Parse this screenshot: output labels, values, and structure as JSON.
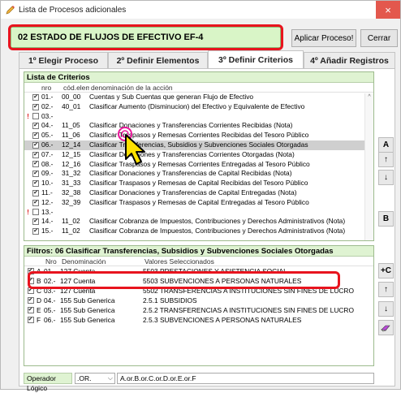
{
  "window": {
    "title": "Lista de Procesos adicionales",
    "close_label": "×"
  },
  "process": {
    "name": "02 ESTADO DE FLUJOS DE EFECTIVO EF-4"
  },
  "buttons": {
    "apply": "Aplicar Proceso!",
    "close": "Cerrar"
  },
  "tabs": [
    {
      "label": "1º Elegir Proceso"
    },
    {
      "label": "2º Definir Elementos"
    },
    {
      "label": "3º Definir Criterios"
    },
    {
      "label": "4º Añadir Registros"
    }
  ],
  "criteria": {
    "title": "Lista de Criterios",
    "headers": {
      "nro": "nro",
      "cod": "cód.elemen",
      "den": "denominación de la acción"
    },
    "rows": [
      {
        "mark": "",
        "checked": "✔",
        "nro": "01.-",
        "cod": "00_00",
        "den": "Cuentas y Sub Cuentas que generan Flujo de Efectivo"
      },
      {
        "mark": "",
        "checked": "✔",
        "nro": "02.-",
        "cod": "40_01",
        "den": "Clasificar Aumento (Disminucion) del Efectivo y Equivalente de Efectivo"
      },
      {
        "mark": "!",
        "checked": "",
        "nro": "03.-",
        "cod": "",
        "den": ""
      },
      {
        "mark": "",
        "checked": "✔",
        "nro": "04.-",
        "cod": "11_05",
        "den": "Clasificar Donaciones y Transferencias Corrientes Recibidas (Nota)"
      },
      {
        "mark": "",
        "checked": "✔",
        "nro": "05.-",
        "cod": "11_06",
        "den": "Clasificar Traspasos y Remesas Corrientes Recibidas del Tesoro Público"
      },
      {
        "mark": "",
        "checked": "✔",
        "nro": "06.-",
        "cod": "12_14",
        "den": "Clasificar Transferencias, Subsidios y Subvenciones Sociales Otorgadas"
      },
      {
        "mark": "",
        "checked": "✔",
        "nro": "07.-",
        "cod": "12_15",
        "den": "Clasificar Donaciones y Transferencias Corrientes Otorgadas (Nota)"
      },
      {
        "mark": "",
        "checked": "✔",
        "nro": "08.-",
        "cod": "12_16",
        "den": "Clasificar Traspasos y Remesas Corrientes Entregadas al Tesoro Público"
      },
      {
        "mark": "",
        "checked": "✔",
        "nro": "09.-",
        "cod": "31_32",
        "den": "Clasificar Donaciones y Transferencias de Capital Recibidas (Nota)"
      },
      {
        "mark": "",
        "checked": "✔",
        "nro": "10.-",
        "cod": "31_33",
        "den": "Clasificar Traspasos y Remesas de Capital Recibidas del Tesoro Público"
      },
      {
        "mark": "",
        "checked": "✔",
        "nro": "11.-",
        "cod": "32_38",
        "den": "Clasificar Donaciones y Transferencias de Capital Entregadas (Nota)"
      },
      {
        "mark": "",
        "checked": "✔",
        "nro": "12.-",
        "cod": "32_39",
        "den": "Clasificar Traspasos y Remesas de Capital Entregadas al Tesoro Público"
      },
      {
        "mark": "!",
        "checked": "",
        "nro": "13.-",
        "cod": "",
        "den": ""
      },
      {
        "mark": "",
        "checked": "✔",
        "nro": "14.-",
        "cod": "11_02",
        "den": "Clasificar Cobranza de Impuestos, Contribuciones y Derechos Administrativos (Nota)"
      },
      {
        "mark": "",
        "checked": "✔",
        "nro": "15.-",
        "cod": "11_02",
        "den": "Clasificar Cobranza de Impuestos, Contribuciones y Derechos Administrativos (Nota)"
      }
    ]
  },
  "side_buttons": {
    "a": "A",
    "up": "↑",
    "down": "↓",
    "b": "B",
    "plusc": "+C",
    "up2": "↑",
    "down2": "↓",
    "eraser": "✎"
  },
  "filters": {
    "title": "Filtros: 06 Clasificar Transferencias, Subsidios y Subvenciones Sociales Otorgadas",
    "headers": {
      "nro": "Nro",
      "den": "Denominación",
      "val": "Valores Seleccionados"
    },
    "rows": [
      {
        "checked": "✔",
        "letter": "A",
        "nro": "01.-",
        "den": "127 Cuenta",
        "val": "5503 PRESTACIONES Y ASISTENCIA SOCIAL"
      },
      {
        "checked": "✔",
        "letter": "B",
        "nro": "02.-",
        "den": "127 Cuenta",
        "val": "5503 SUBVENCIONES A PERSONAS NATURALES"
      },
      {
        "checked": "✔",
        "letter": "C",
        "nro": "03.-",
        "den": "127 Cuenta",
        "val": "5502 TRANSFERENCIAS A INSTITUCIONES SIN FINES DE LUCRO"
      },
      {
        "checked": "✔",
        "letter": "D",
        "nro": "04.-",
        "den": "155 Sub Generica",
        "val": "2.5.1 SUBSIDIOS"
      },
      {
        "checked": "✔",
        "letter": "E",
        "nro": "05.-",
        "den": "155 Sub Generica",
        "val": "2.5.2 TRANSFERENCIAS A INSTITUCIONES SIN FINES DE LUCRO"
      },
      {
        "checked": "✔",
        "letter": "F",
        "nro": "06.-",
        "den": "155 Sub Generica",
        "val": "2.5.3 SUBVENCIONES A PERSONAS NATURALES"
      }
    ]
  },
  "operator": {
    "label": "Operador Lógico",
    "value": ".OR.",
    "expression": "A.or.B.or.C.or.D.or.E.or.F"
  },
  "colors": {
    "highlight": "#e8141e",
    "green_header": "#dff3d2",
    "process_bg": "#d9f5c7"
  }
}
